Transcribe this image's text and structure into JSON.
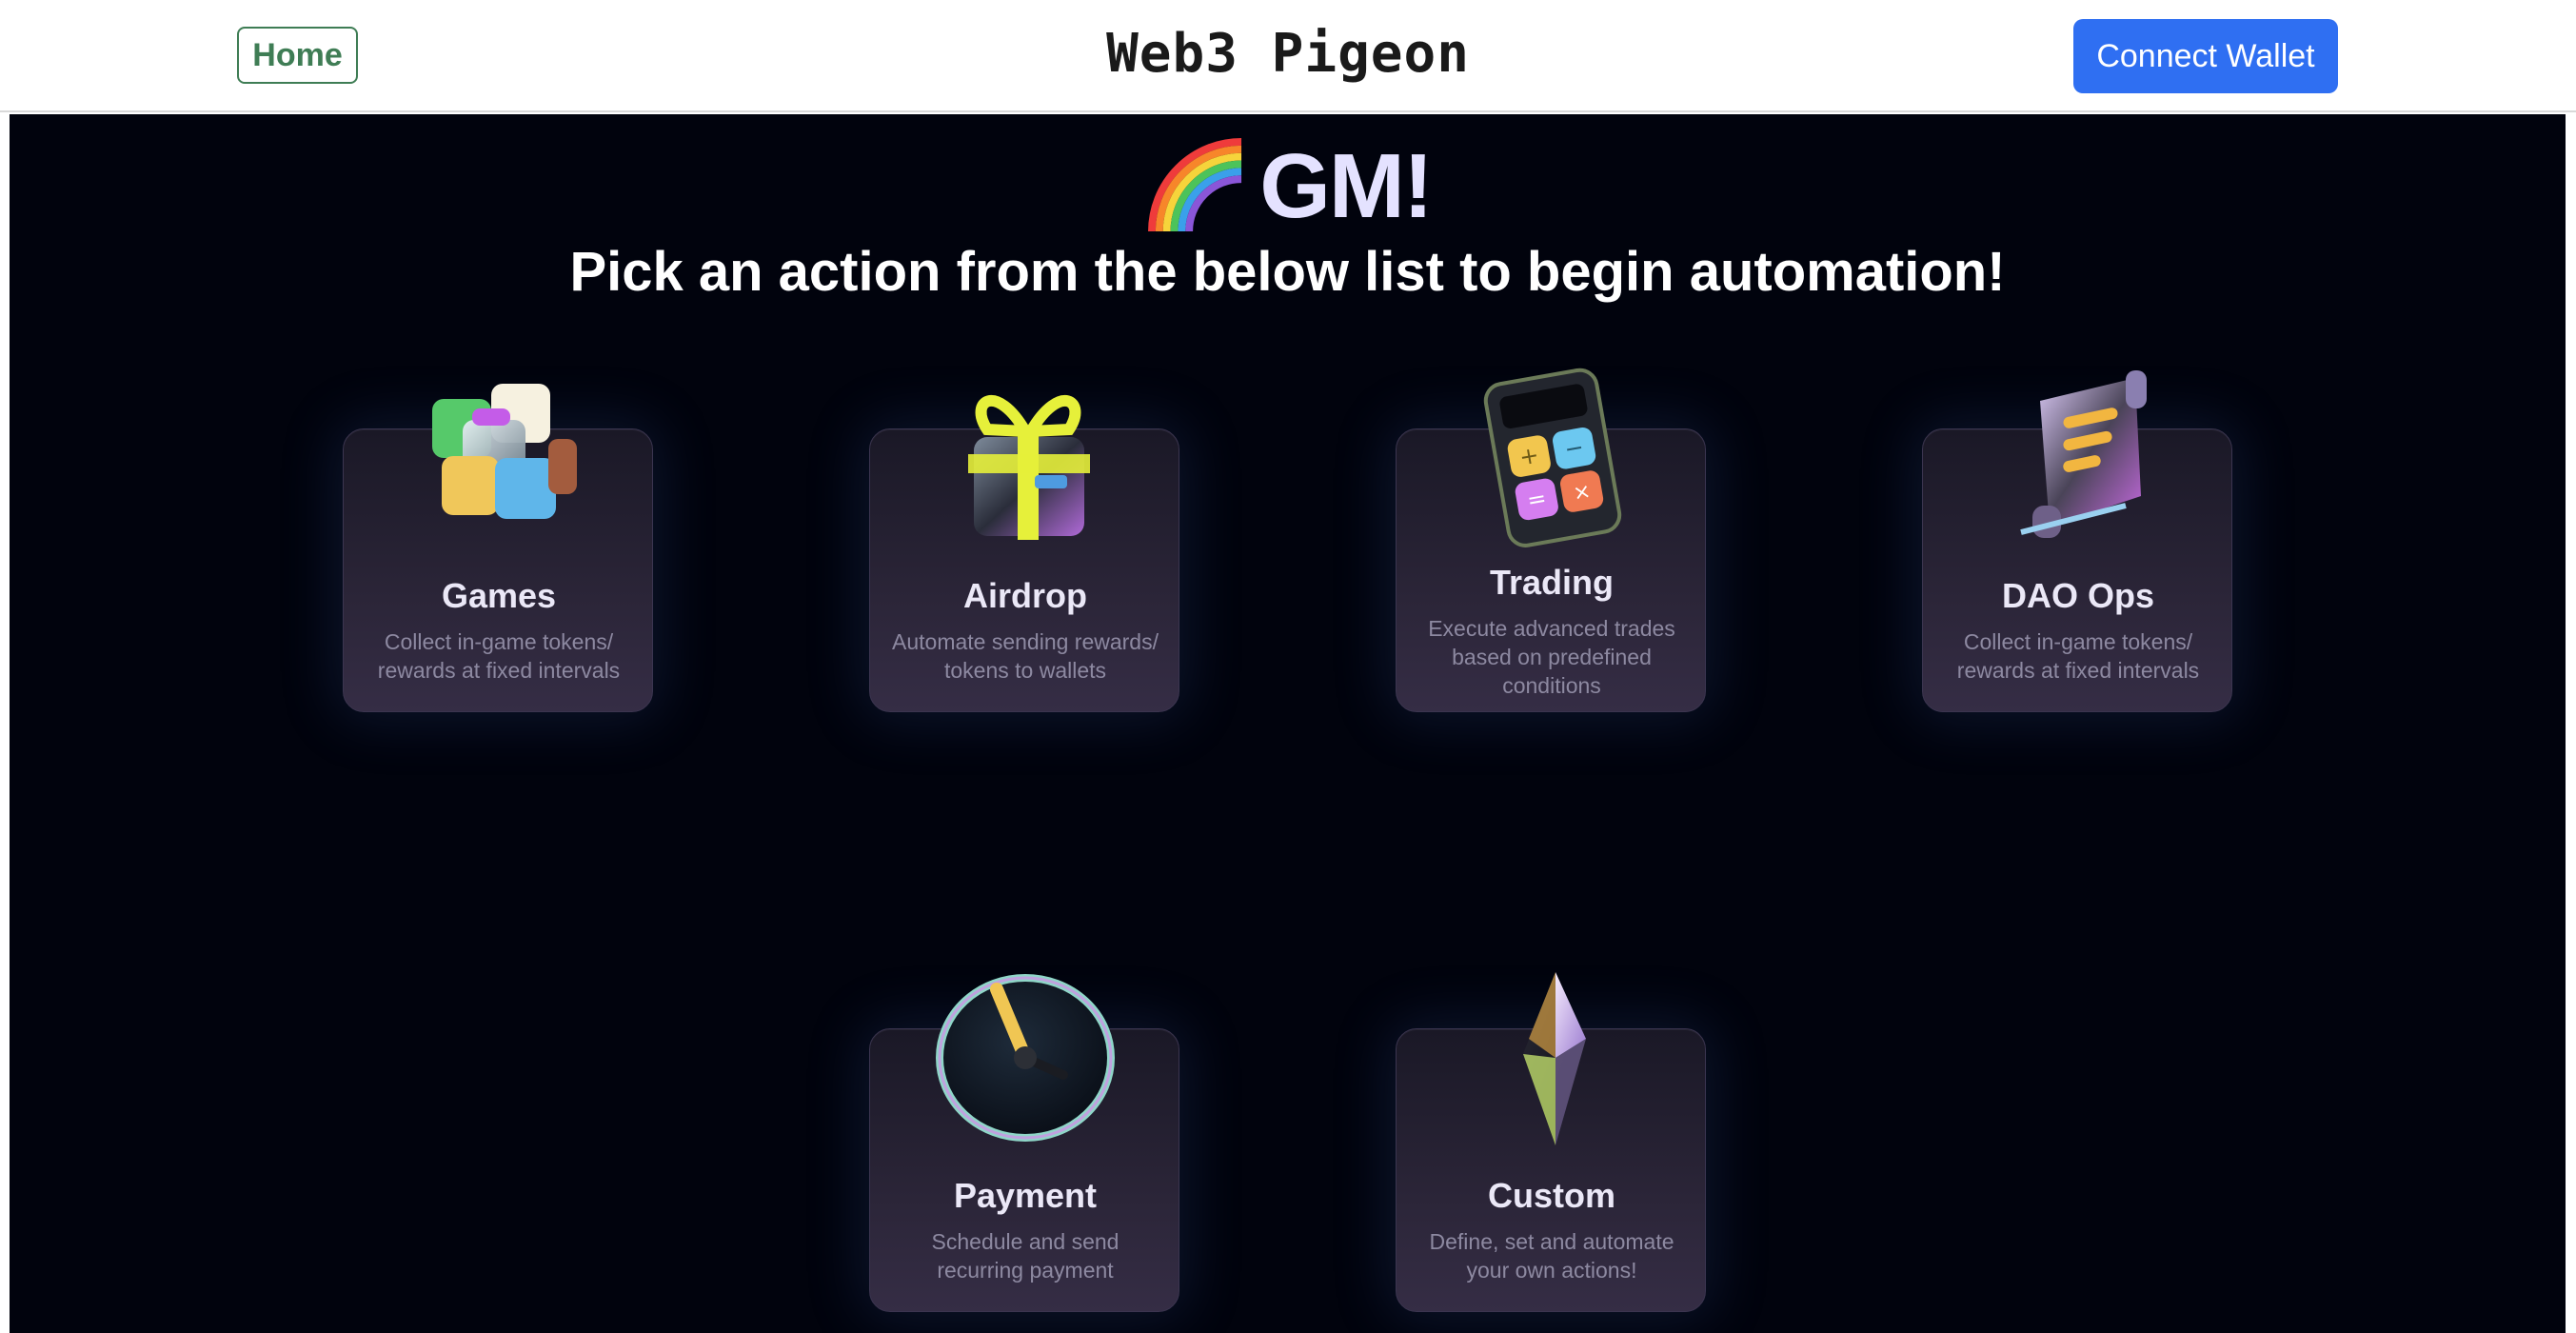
{
  "navbar": {
    "home_label": "Home",
    "brand": "Web3 Pigeon",
    "connect_label": "Connect Wallet"
  },
  "hero": {
    "greeting": "GM!",
    "greeting_icon": "rainbow-icon",
    "subtitle": "Pick an action from the below list to begin automation!"
  },
  "actions": [
    {
      "title": "Games",
      "description": "Collect in-game tokens/ rewards at fixed intervals",
      "icon": "cube-icon"
    },
    {
      "title": "Airdrop",
      "description": "Automate sending rewards/ tokens to wallets",
      "icon": "gift-icon"
    },
    {
      "title": "Trading",
      "description": "Execute advanced trades based on predefined conditions",
      "icon": "calculator-icon"
    },
    {
      "title": "DAO Ops",
      "description": "Collect in-game tokens/ rewards at fixed intervals",
      "icon": "scroll-icon"
    },
    {
      "title": "Payment",
      "description": "Schedule and send recurring payment",
      "icon": "clock-icon"
    },
    {
      "title": "Custom",
      "description": "Define, set and automate your own actions!",
      "icon": "crystal-icon"
    }
  ],
  "colors": {
    "stage_background": "#01030d",
    "primary_button": "#2f6ff2",
    "home_button": "#3f7d55",
    "card_title": "#ebe8f7",
    "card_text": "#8d89a1"
  }
}
